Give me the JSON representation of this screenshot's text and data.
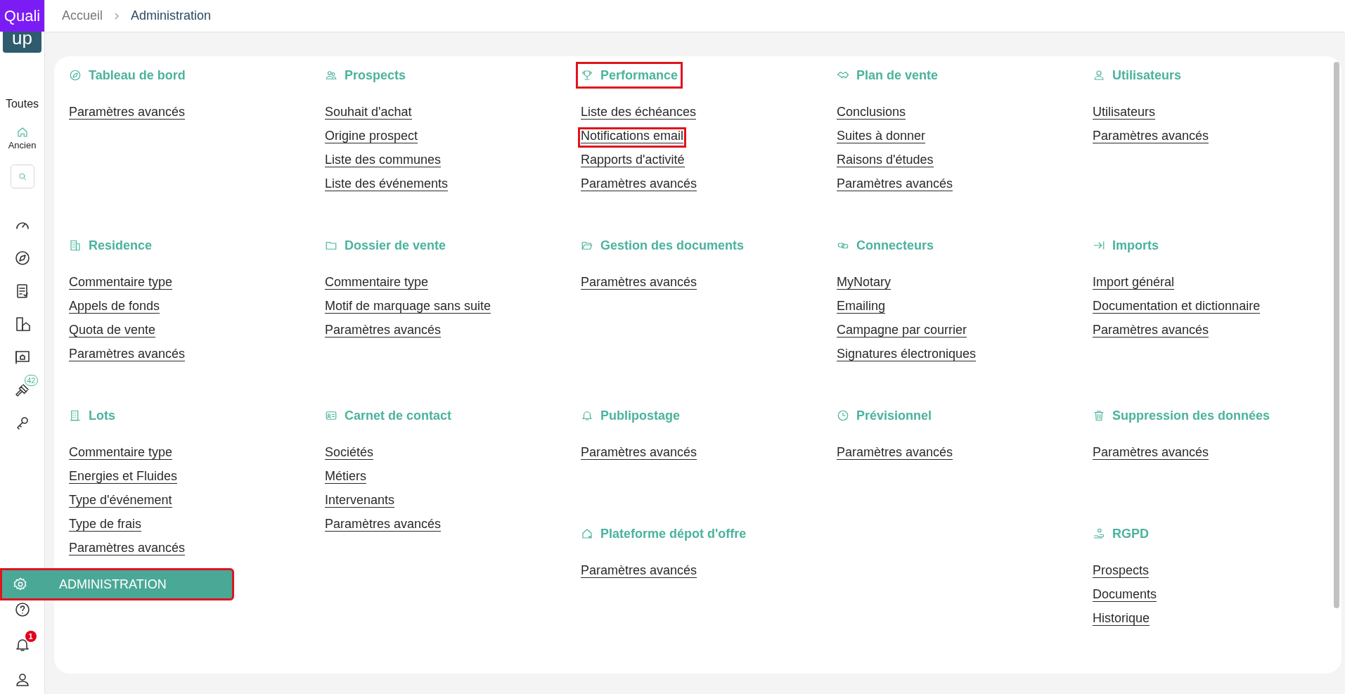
{
  "sidebar": {
    "logo_top": "Quali",
    "logo_bottom": "up",
    "filter_label": "Toutes",
    "home": {
      "label": "Ancien",
      "selected": false
    },
    "nav": [
      {
        "selected": false
      },
      {
        "selected": false
      },
      {
        "selected": false
      },
      {
        "selected": false
      },
      {
        "selected": false
      },
      {
        "selected": false,
        "badge": "42"
      },
      {
        "selected": false
      }
    ],
    "admin": {
      "label": "ADMINISTRATION",
      "selected": true,
      "highlighted": true
    },
    "bottom": [
      {
        "selected": false
      },
      {
        "selected": false,
        "badge": "1"
      },
      {
        "selected": false
      }
    ]
  },
  "breadcrumb": [
    "Accueil",
    "Administration"
  ],
  "rows": [
    {
      "cells": [
        {
          "sections": [
            {
              "title": "Tableau de bord",
              "highlighted": false,
              "links": [
                {
                  "label": "Paramètres avancés",
                  "highlighted": false
                }
              ]
            }
          ]
        },
        {
          "sections": [
            {
              "title": "Prospects",
              "highlighted": false,
              "links": [
                {
                  "label": "Souhait d'achat",
                  "highlighted": false
                },
                {
                  "label": "Origine prospect",
                  "highlighted": false
                },
                {
                  "label": "Liste des communes",
                  "highlighted": false
                },
                {
                  "label": "Liste des événements",
                  "highlighted": false
                }
              ]
            }
          ]
        },
        {
          "sections": [
            {
              "title": "Performance",
              "highlighted": true,
              "links": [
                {
                  "label": "Liste des échéances",
                  "highlighted": false
                },
                {
                  "label": "Notifications email",
                  "highlighted": true
                },
                {
                  "label": "Rapports d'activité",
                  "highlighted": false
                },
                {
                  "label": "Paramètres avancés",
                  "highlighted": false
                }
              ]
            }
          ]
        },
        {
          "sections": [
            {
              "title": "Plan de vente",
              "highlighted": false,
              "links": [
                {
                  "label": "Conclusions",
                  "highlighted": false
                },
                {
                  "label": "Suites à donner",
                  "highlighted": false
                },
                {
                  "label": "Raisons d'études",
                  "highlighted": false
                },
                {
                  "label": "Paramètres avancés",
                  "highlighted": false
                }
              ]
            }
          ]
        },
        {
          "sections": [
            {
              "title": "Utilisateurs",
              "highlighted": false,
              "links": [
                {
                  "label": "Utilisateurs",
                  "highlighted": false
                },
                {
                  "label": "Paramètres avancés",
                  "highlighted": false
                }
              ]
            }
          ]
        }
      ]
    },
    {
      "cells": [
        {
          "sections": [
            {
              "title": "Residence",
              "highlighted": false,
              "links": [
                {
                  "label": "Commentaire type",
                  "highlighted": false
                },
                {
                  "label": "Appels de fonds",
                  "highlighted": false
                },
                {
                  "label": "Quota de vente",
                  "highlighted": false
                },
                {
                  "label": "Paramètres avancés",
                  "highlighted": false
                }
              ]
            }
          ]
        },
        {
          "sections": [
            {
              "title": "Dossier de vente",
              "highlighted": false,
              "links": [
                {
                  "label": "Commentaire type",
                  "highlighted": false
                },
                {
                  "label": "Motif de marquage sans suite",
                  "highlighted": false
                },
                {
                  "label": "Paramètres avancés",
                  "highlighted": false
                }
              ]
            }
          ]
        },
        {
          "sections": [
            {
              "title": "Gestion des documents",
              "highlighted": false,
              "links": [
                {
                  "label": "Paramètres avancés",
                  "highlighted": false
                }
              ]
            }
          ]
        },
        {
          "sections": [
            {
              "title": "Connecteurs",
              "highlighted": false,
              "links": [
                {
                  "label": "MyNotary",
                  "highlighted": false
                },
                {
                  "label": "Emailing",
                  "highlighted": false
                },
                {
                  "label": "Campagne par courrier",
                  "highlighted": false
                },
                {
                  "label": "Signatures électroniques",
                  "highlighted": false
                }
              ]
            }
          ]
        },
        {
          "sections": [
            {
              "title": "Imports",
              "highlighted": false,
              "links": [
                {
                  "label": "Import général",
                  "highlighted": false
                },
                {
                  "label": "Documentation et dictionnaire",
                  "highlighted": false
                },
                {
                  "label": "Paramètres avancés",
                  "highlighted": false
                }
              ]
            }
          ]
        }
      ]
    },
    {
      "cells": [
        {
          "sections": [
            {
              "title": "Lots",
              "highlighted": false,
              "links": [
                {
                  "label": "Commentaire type",
                  "highlighted": false
                },
                {
                  "label": "Energies et Fluides",
                  "highlighted": false
                },
                {
                  "label": "Type d'événement",
                  "highlighted": false
                },
                {
                  "label": "Type de frais",
                  "highlighted": false
                },
                {
                  "label": "Paramètres avancés",
                  "highlighted": false
                }
              ]
            }
          ]
        },
        {
          "sections": [
            {
              "title": "Carnet de contact",
              "highlighted": false,
              "links": [
                {
                  "label": "Sociétés",
                  "highlighted": false
                },
                {
                  "label": "Métiers",
                  "highlighted": false
                },
                {
                  "label": "Intervenants",
                  "highlighted": false
                },
                {
                  "label": "Paramètres avancés",
                  "highlighted": false
                }
              ]
            }
          ]
        },
        {
          "sections": [
            {
              "title": "Publipostage",
              "highlighted": false,
              "links": [
                {
                  "label": "Paramètres avancés",
                  "highlighted": false
                }
              ]
            },
            {
              "title": "Plateforme dépot d'offre",
              "highlighted": false,
              "links": [
                {
                  "label": "Paramètres avancés",
                  "highlighted": false
                }
              ]
            }
          ]
        },
        {
          "sections": [
            {
              "title": "Prévisionnel",
              "highlighted": false,
              "links": [
                {
                  "label": "Paramètres avancés",
                  "highlighted": false
                }
              ]
            }
          ]
        },
        {
          "sections": [
            {
              "title": "Suppression des données",
              "highlighted": false,
              "links": [
                {
                  "label": "Paramètres avancés",
                  "highlighted": false
                }
              ]
            },
            {
              "title": "RGPD",
              "highlighted": false,
              "links": [
                {
                  "label": "Prospects",
                  "highlighted": false
                },
                {
                  "label": "Documents",
                  "highlighted": false
                },
                {
                  "label": "Historique",
                  "highlighted": false
                }
              ]
            }
          ]
        }
      ]
    }
  ]
}
